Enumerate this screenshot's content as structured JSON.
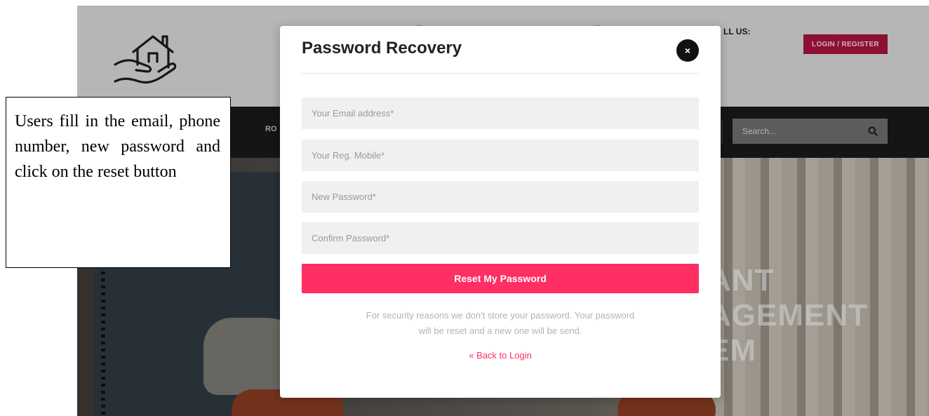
{
  "site": {
    "topbar_call_text": "LL US:",
    "login_register_label": "LOGIN / REGISTER",
    "nav_items": [
      "RO"
    ],
    "search_placeholder": "Search...",
    "hero_lines": [
      "ANT",
      "AGEMENT",
      "EM"
    ]
  },
  "annotation": {
    "text": "Users fill in the email, phone number, new password and click on the reset button"
  },
  "modal": {
    "title": "Password Recovery",
    "close_label": "×",
    "fields": {
      "email_placeholder": "Your Email address*",
      "mobile_placeholder": "Your Reg. Mobile*",
      "new_password_placeholder": "New Password*",
      "confirm_password_placeholder": "Confirm Password*"
    },
    "reset_button_label": "Reset My Password",
    "note_line_1": "For security reasons we don't store your password. Your password",
    "note_line_2": "will be reset and a new one will be send.",
    "back_icon": "«",
    "back_link_label": "Back to Login"
  },
  "colors": {
    "accent": "#ff2e63",
    "login_button": "#a8133d",
    "navbar": "#1a1a1a"
  }
}
